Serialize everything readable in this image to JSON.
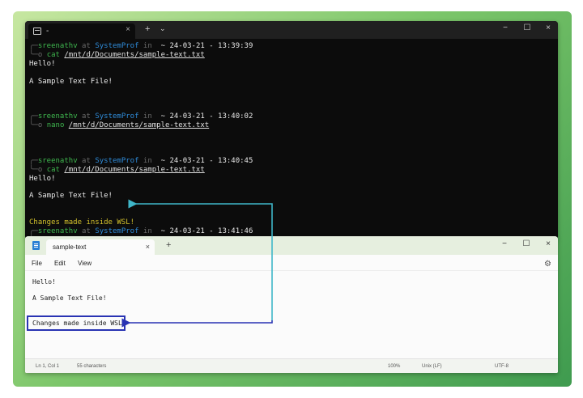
{
  "terminal": {
    "tab_label": "-",
    "new_tab": "+",
    "dropdown": "⌄",
    "tab_close": "×",
    "window_controls": {
      "minimize": "−",
      "maximize": "☐",
      "close": "×"
    },
    "blocks": [
      {
        "user": "sreenathv",
        "at": " at ",
        "host": "SystemProf",
        "in": " in ",
        "time": "~ 24-03-21 - 13:39:39",
        "cmd": "cat",
        "path": "/mnt/d/Documents/sample-text.txt",
        "output": [
          "Hello!",
          "",
          "A Sample Text File!"
        ]
      },
      {
        "user": "sreenathv",
        "at": " at ",
        "host": "SystemProf",
        "in": " in ",
        "time": "~ 24-03-21 - 13:40:02",
        "cmd": "nano",
        "path": "/mnt/d/Documents/sample-text.txt",
        "output": []
      },
      {
        "user": "sreenathv",
        "at": " at ",
        "host": "SystemProf",
        "in": " in ",
        "time": "~ 24-03-21 - 13:40:45",
        "cmd": "cat",
        "path": "/mnt/d/Documents/sample-text.txt",
        "output": [
          "Hello!",
          "",
          "A Sample Text File!"
        ]
      }
    ],
    "highlight_line": "Changes made inside WSL!",
    "last_prompt": {
      "user": "sreenathv",
      "at": " at ",
      "host": "SystemProf",
      "in": " in ",
      "time": "~ 24-03-21 - 13:41:46"
    },
    "prompt_top": "╭─",
    "prompt_bottom": "╰─o"
  },
  "notepad": {
    "tab_title": "sample-text",
    "tab_close": "×",
    "new_tab": "+",
    "window_controls": {
      "minimize": "−",
      "maximize": "☐",
      "close": "×"
    },
    "menu": {
      "file": "File",
      "edit": "Edit",
      "view": "View"
    },
    "lines": [
      "Hello!",
      "",
      "A Sample Text File!",
      "",
      "",
      "Changes made inside WSL!"
    ],
    "status": {
      "position": "Ln 1, Col 1",
      "chars": "55 characters",
      "zoom": "100%",
      "eol": "Unix (LF)",
      "encoding": "UTF-8"
    }
  },
  "colors": {
    "arrow_cyan": "#3fb6c9",
    "arrow_blue": "#2933b3",
    "user_green": "#3fb84f",
    "host_blue": "#2f8bd8",
    "highlight_yellow": "#d4c22c"
  }
}
